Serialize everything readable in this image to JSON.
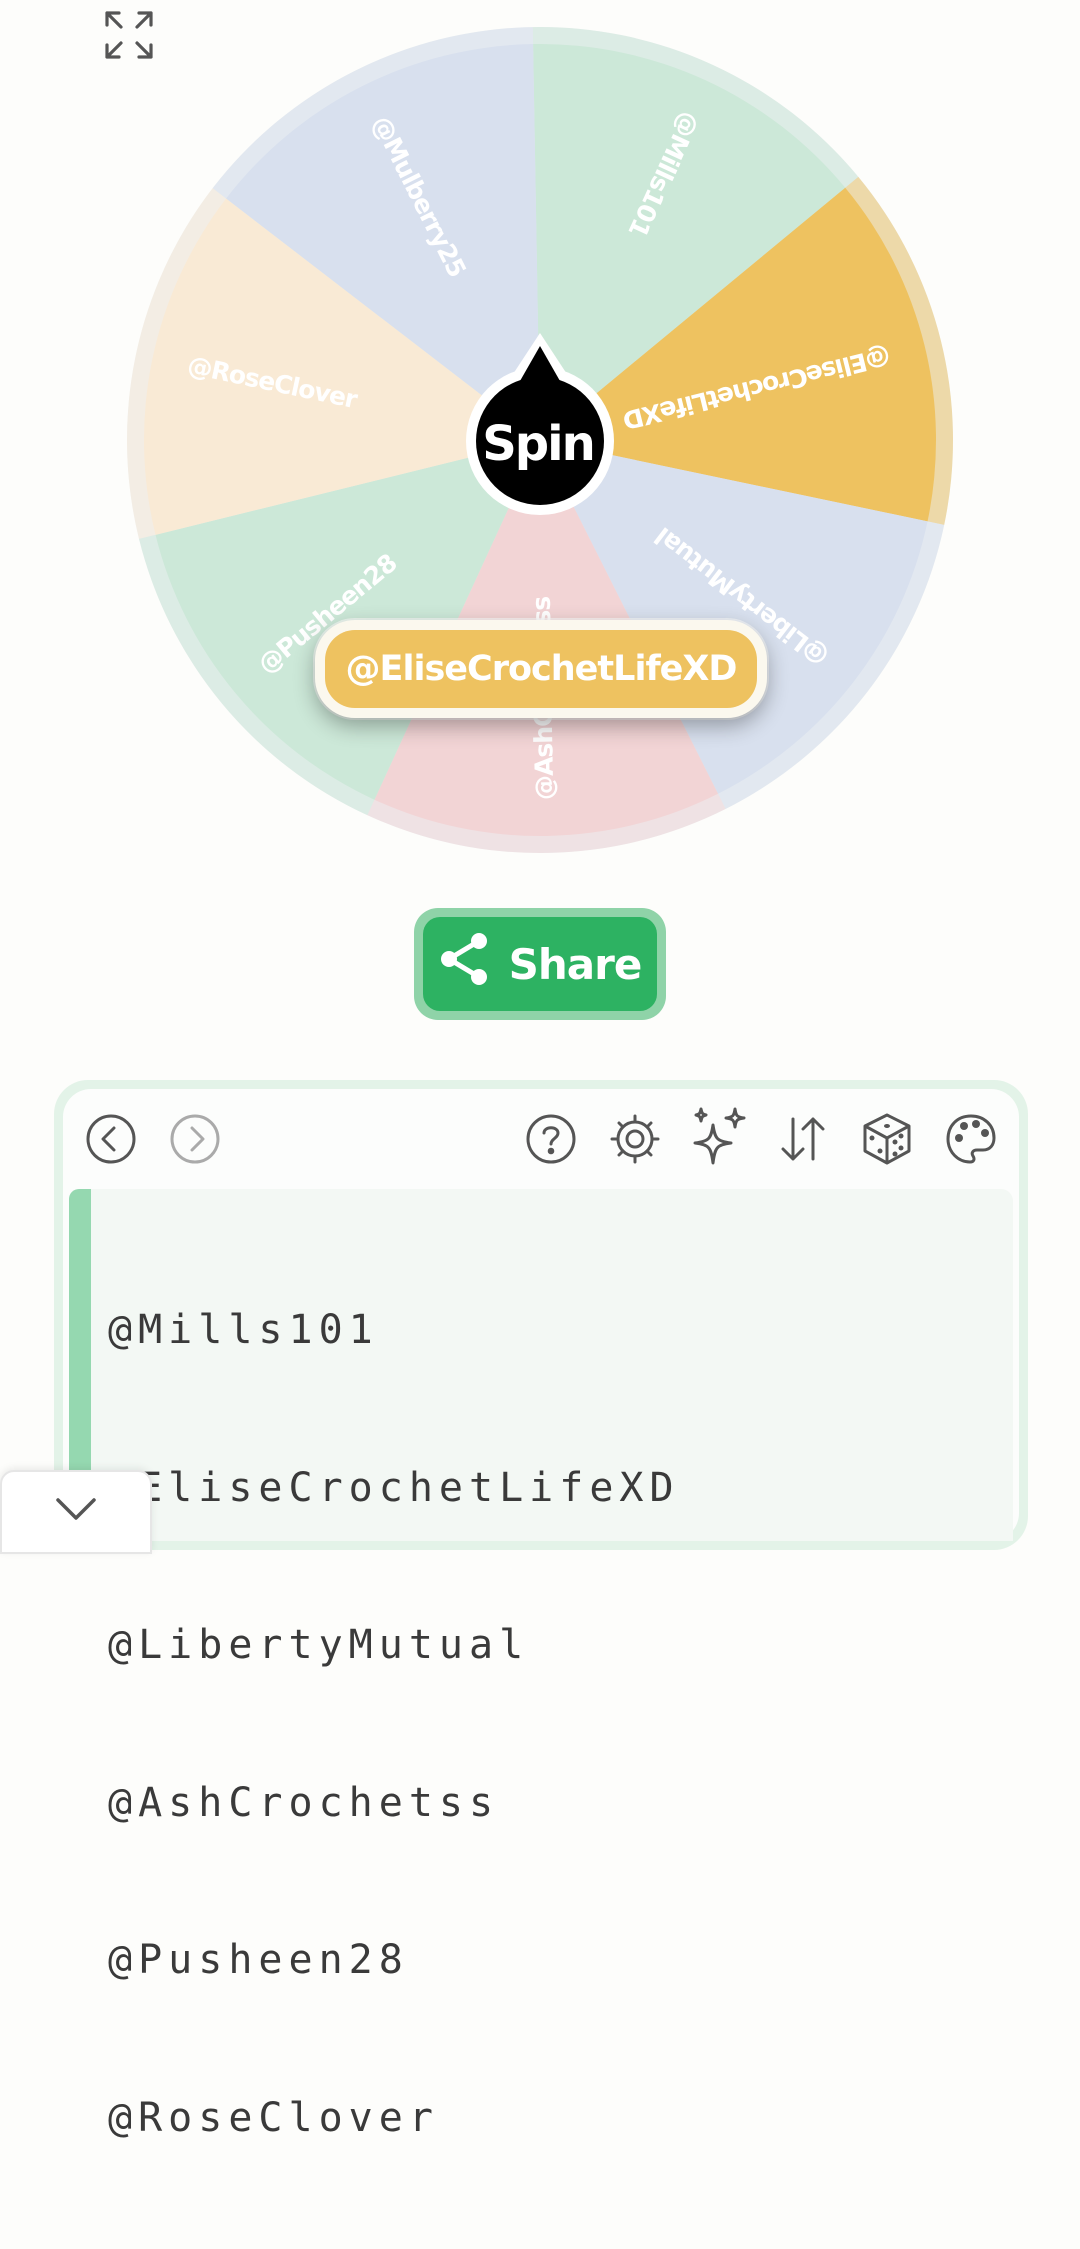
{
  "wheel": {
    "segments": [
      {
        "label": "@Mills101",
        "color": "#cce8d8"
      },
      {
        "label": "@EliseCrochetLifeXD",
        "color": "#eec260"
      },
      {
        "label": "@LibertyMutual",
        "color": "#d8e0ee"
      },
      {
        "label": "@AshCrochetss",
        "color": "#f2d4d5"
      },
      {
        "label": "@Pusheen28",
        "color": "#cce8d8"
      },
      {
        "label": "@RoseClover",
        "color": "#f9ead5"
      },
      {
        "label": "@Mulberry25",
        "color": "#d8e0ee"
      }
    ],
    "spin_label": "Spin",
    "result": "@EliseCrochetLifeXD"
  },
  "share": {
    "label": "Share"
  },
  "toolbar": {
    "icons": [
      "back-icon",
      "forward-icon",
      "help-icon",
      "settings-icon",
      "sparkles-icon",
      "sort-icon",
      "dice-icon",
      "palette-icon"
    ]
  },
  "entries": {
    "lines": [
      "@Mills101",
      "@EliseCrochetLifeXD",
      "@LibertyMutual",
      "@AshCrochetss",
      "@Pusheen28",
      "@RoseClover"
    ]
  },
  "colors": {
    "accent": "#2db262",
    "accent_light": "#8fd3a8",
    "result": "#eec260"
  }
}
